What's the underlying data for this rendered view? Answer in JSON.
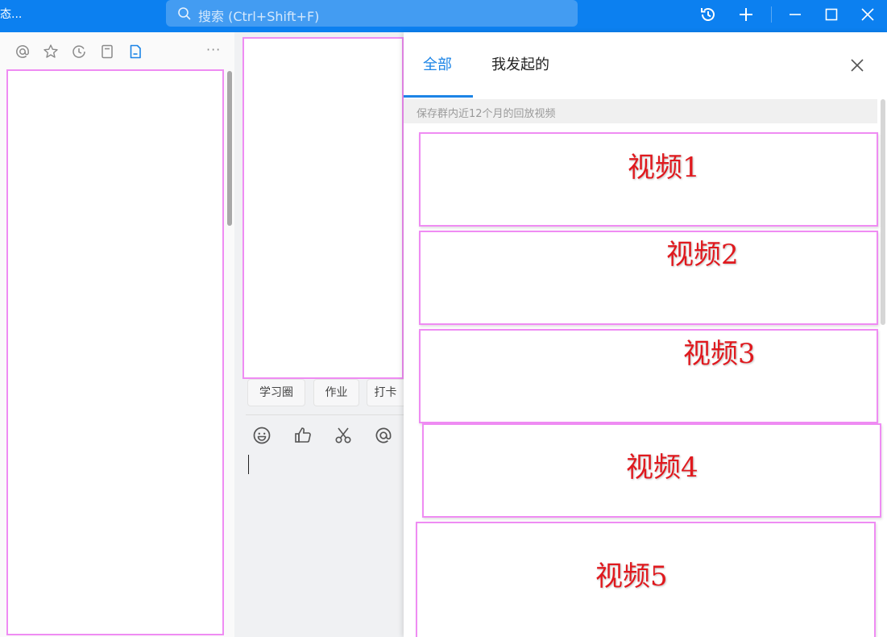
{
  "titlebar": {
    "status_text": "态...",
    "search": {
      "placeholder": "搜索 (Ctrl+Shift+F)"
    },
    "buttons": [
      "history-icon",
      "plus-icon",
      "minimize-icon",
      "maximize-icon",
      "window-close-icon"
    ]
  },
  "left_panel": {
    "tabs": [
      "at-icon",
      "star-icon",
      "recent-icon",
      "bookmark-icon",
      "document-icon"
    ],
    "active_tab_color": "#1c84e6",
    "more": "···"
  },
  "mid_panel": {
    "chips": [
      "学习圈",
      "作业",
      "打卡"
    ],
    "toolbar": [
      "emoji-icon",
      "thumbs-up-icon",
      "scissors-icon",
      "at-icon"
    ]
  },
  "right_panel": {
    "tabs": [
      {
        "label": "全部",
        "active": true
      },
      {
        "label": "我发起的",
        "active": false
      }
    ],
    "notice": "保存群内近12个月的回放视频",
    "videos": [
      {
        "label": "视频1"
      },
      {
        "label": "视频2"
      },
      {
        "label": "视频3"
      },
      {
        "label": "视频4"
      },
      {
        "label": "视频5"
      }
    ]
  },
  "colors": {
    "titlebar": "#0c80f0",
    "accent": "#1c84e6",
    "annotation_border": "#ef8cf3",
    "annotation_text": "#e0191e"
  }
}
